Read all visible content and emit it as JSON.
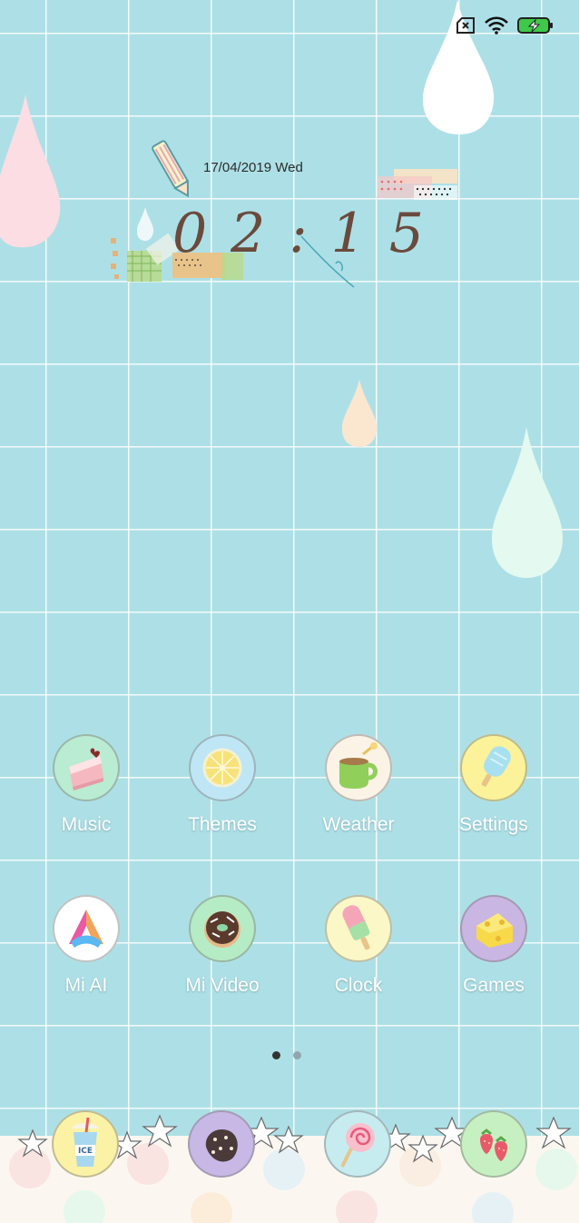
{
  "status_bar": {
    "icons": [
      "no-sim-icon",
      "wifi-icon",
      "battery-charging-icon"
    ]
  },
  "widget": {
    "date": "17/04/2019 Wed",
    "time": "02:15"
  },
  "apps": [
    {
      "label": "Music",
      "icon": "cake-icon",
      "color": "#b9ecd2"
    },
    {
      "label": "Themes",
      "icon": "lemon-icon",
      "color": "#bfe6f4"
    },
    {
      "label": "Weather",
      "icon": "cup-icon",
      "color": "#fbf3e6"
    },
    {
      "label": "Settings",
      "icon": "popsicle-icon",
      "color": "#fbf29a"
    },
    {
      "label": "Mi AI",
      "icon": "mi-ai-icon",
      "color": "#ffffff"
    },
    {
      "label": "Mi Video",
      "icon": "donut-icon",
      "color": "#b6ecc5"
    },
    {
      "label": "Clock",
      "icon": "ice-pop-icon",
      "color": "#fbf7c6"
    },
    {
      "label": "Games",
      "icon": "cheese-icon",
      "color": "#c9b6e2"
    }
  ],
  "pager": {
    "current": 1,
    "total": 2
  },
  "dock": [
    {
      "icon": "ice-drink-icon",
      "color": "#fbf2a6",
      "text": "ICE"
    },
    {
      "icon": "cookie-icon",
      "color": "#c8b8e6"
    },
    {
      "icon": "lollipop-icon",
      "color": "#c7ecf0"
    },
    {
      "icon": "strawberry-icon",
      "color": "#c7f0c2"
    }
  ]
}
